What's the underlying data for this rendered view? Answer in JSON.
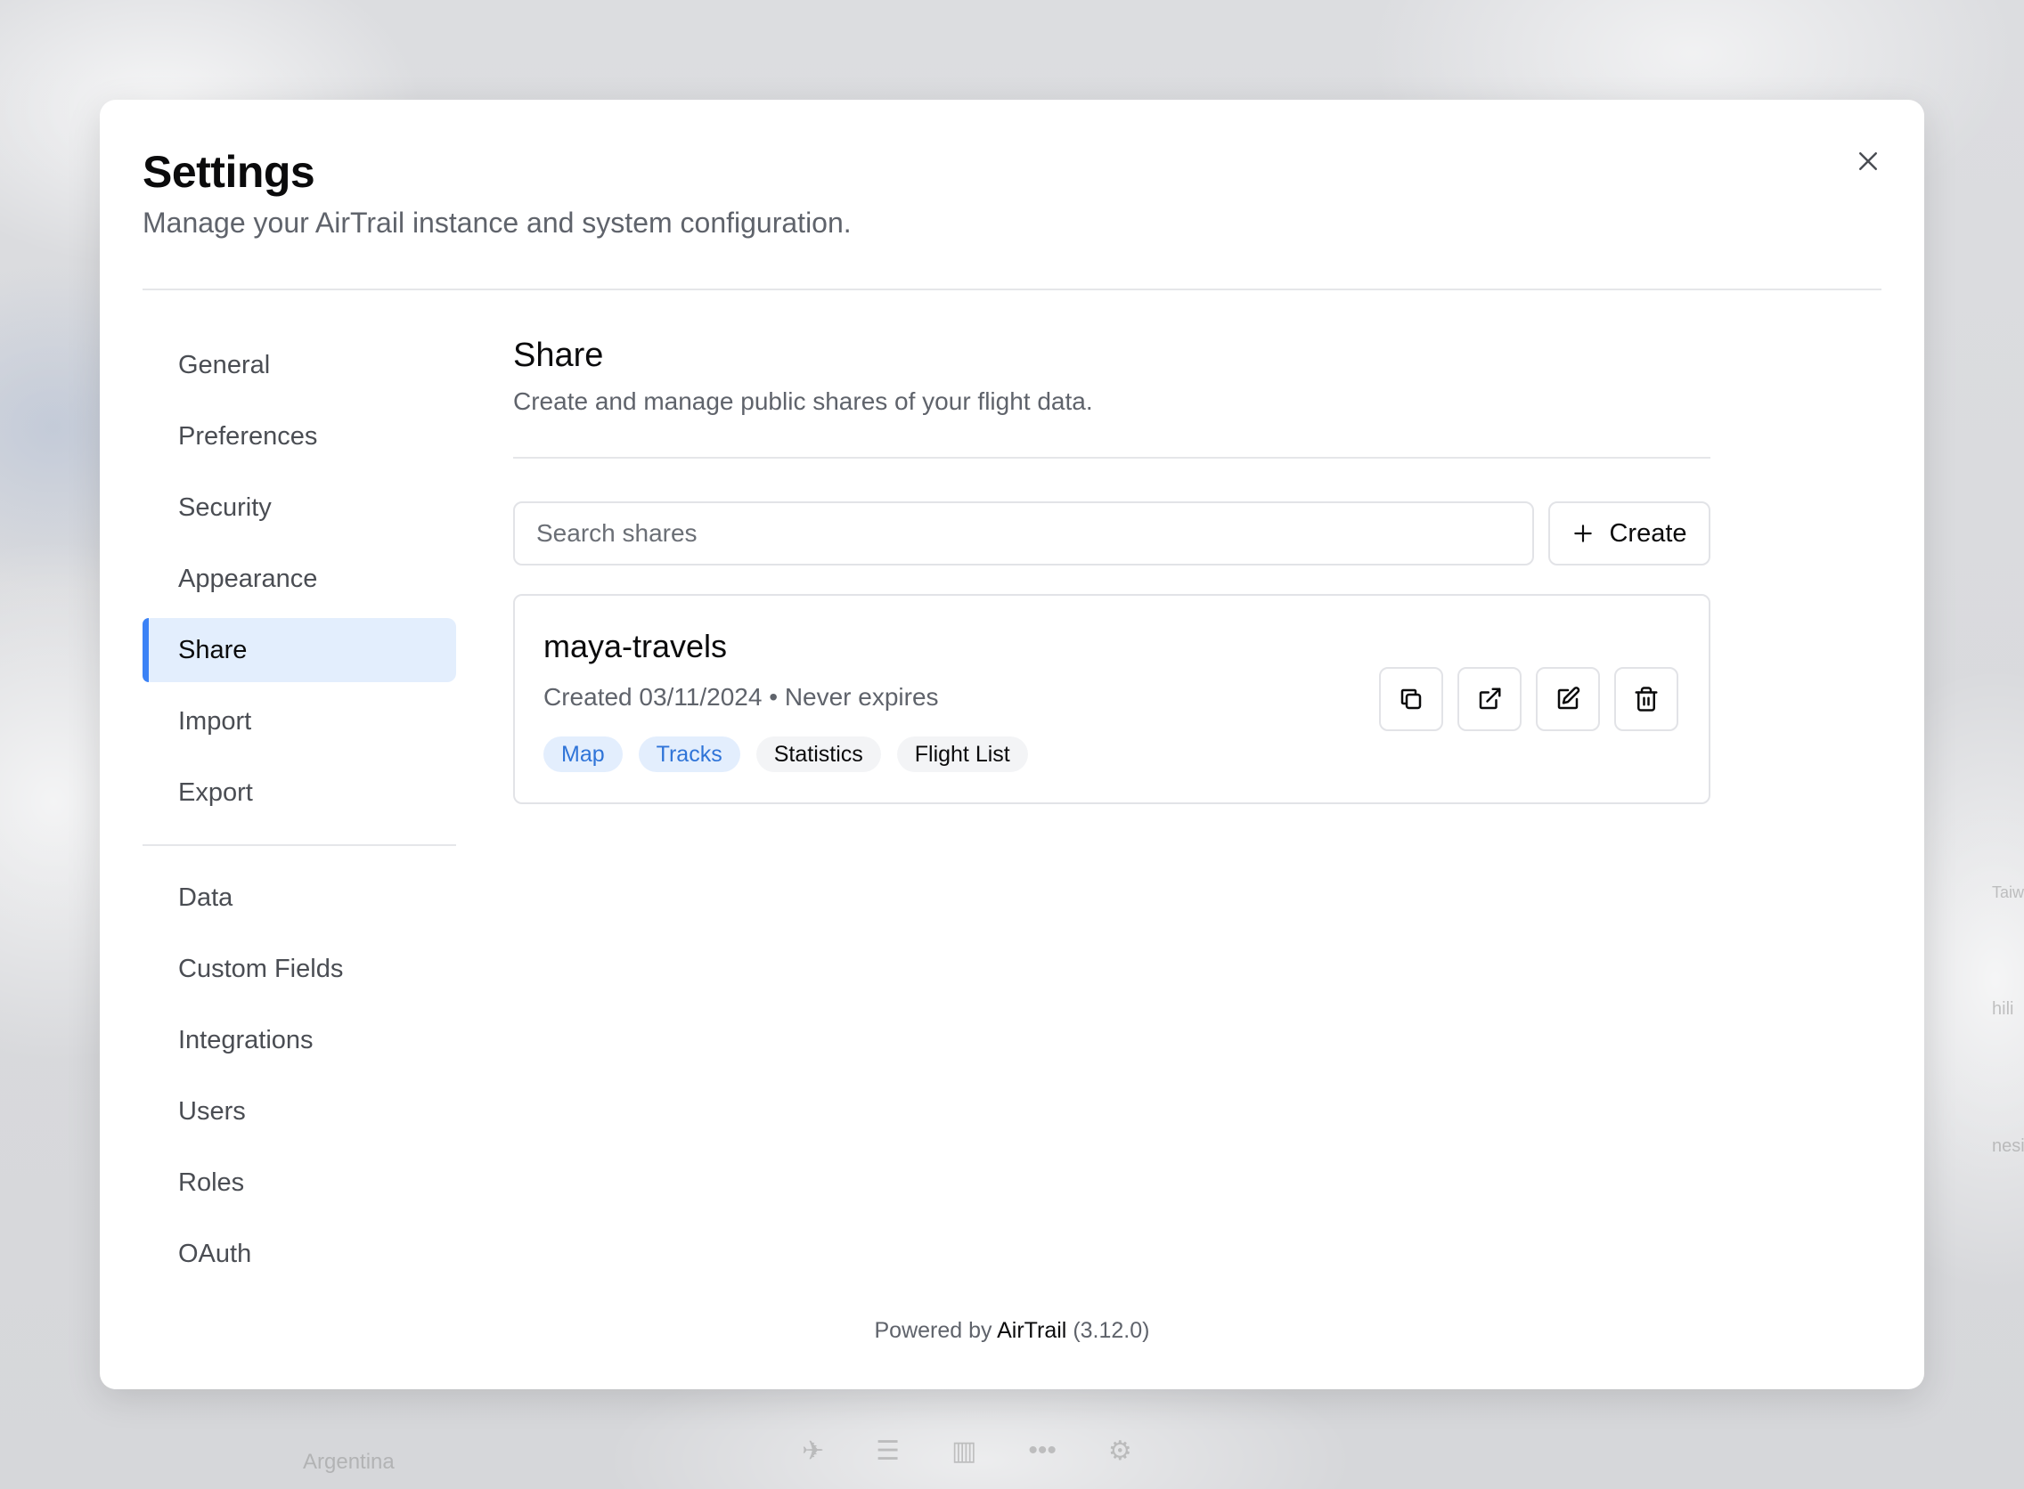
{
  "background": {
    "map_labels": [
      "Argentina",
      "Taiw",
      "hili",
      "nesi"
    ]
  },
  "modal": {
    "title": "Settings",
    "subtitle": "Manage your AirTrail instance and system configuration."
  },
  "sidebar": {
    "items": [
      {
        "label": "General",
        "active": false
      },
      {
        "label": "Preferences",
        "active": false
      },
      {
        "label": "Security",
        "active": false
      },
      {
        "label": "Appearance",
        "active": false
      },
      {
        "label": "Share",
        "active": true
      },
      {
        "label": "Import",
        "active": false
      },
      {
        "label": "Export",
        "active": false
      }
    ],
    "admin_items": [
      {
        "label": "Data"
      },
      {
        "label": "Custom Fields"
      },
      {
        "label": "Integrations"
      },
      {
        "label": "Users"
      },
      {
        "label": "Roles"
      },
      {
        "label": "OAuth"
      }
    ]
  },
  "share": {
    "title": "Share",
    "subtitle": "Create and manage public shares of your flight data.",
    "search_placeholder": "Search shares",
    "create_label": "Create",
    "items": [
      {
        "name": "maya-travels",
        "meta": "Created 03/11/2024 • Never expires",
        "tags": [
          {
            "label": "Map",
            "enabled": true
          },
          {
            "label": "Tracks",
            "enabled": true
          },
          {
            "label": "Statistics",
            "enabled": false
          },
          {
            "label": "Flight List",
            "enabled": false
          }
        ],
        "actions": [
          "copy-icon",
          "external-link-icon",
          "edit-icon",
          "trash-icon"
        ]
      }
    ]
  },
  "footer": {
    "prefix": "Powered by",
    "brand": "AirTrail",
    "version": "(3.12.0)"
  },
  "colors": {
    "accent": "#3b82f6",
    "active_bg": "#e3eefd",
    "tag_on_text": "#2f74d8"
  }
}
